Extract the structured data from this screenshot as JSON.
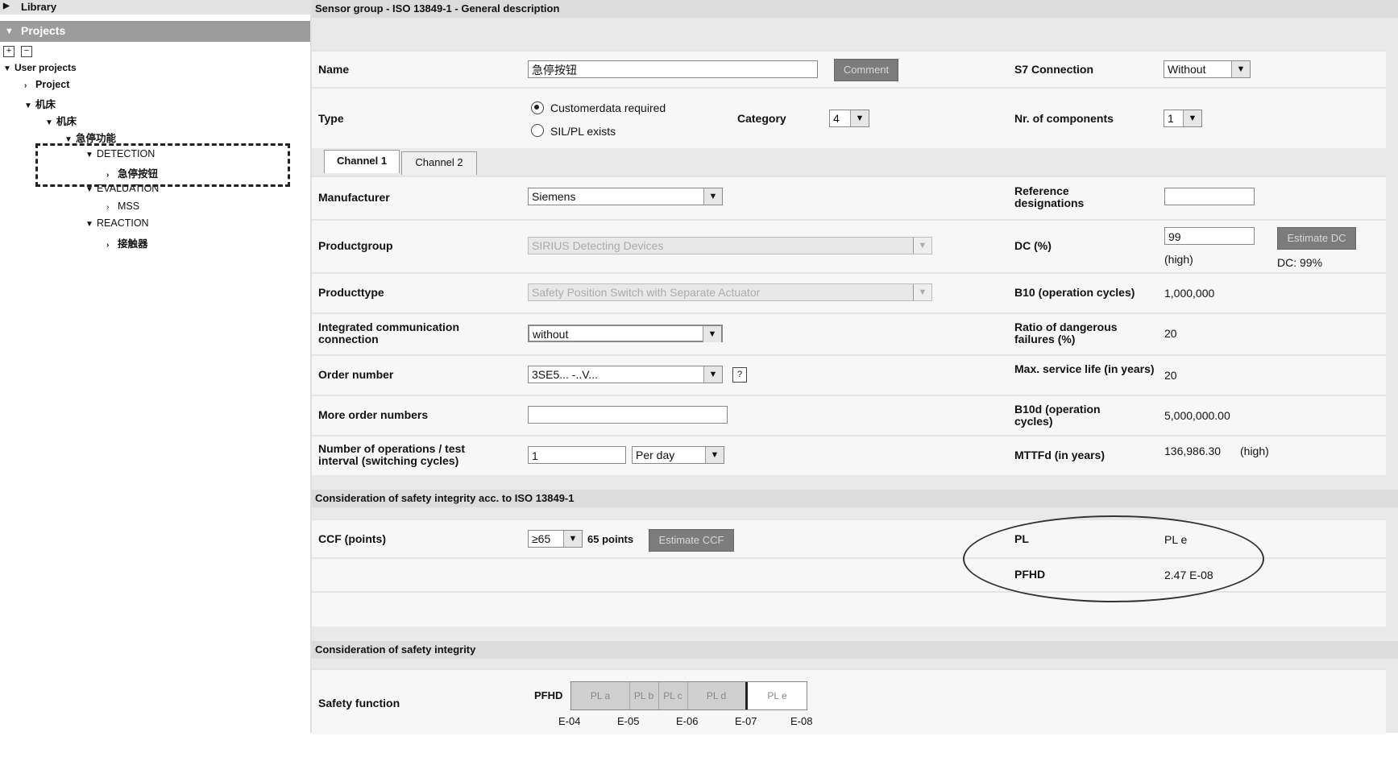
{
  "tree": {
    "library": "Library",
    "projects": "Projects",
    "expand_btn": "+",
    "collapse_btn": "−",
    "nodes": [
      {
        "label": "User projects",
        "tri": "▼"
      },
      {
        "label": "Project",
        "tri": "›"
      },
      {
        "label": "机床",
        "tri": "▼"
      },
      {
        "label": "机床",
        "tri": "▼"
      },
      {
        "label": "急停功能",
        "tri": "▼"
      },
      {
        "label": "DETECTION",
        "tri": "▼"
      },
      {
        "label": "急停按钮",
        "tri": "›"
      },
      {
        "label": "EVALUATION",
        "tri": "▼"
      },
      {
        "label": "MSS",
        "tri": "›"
      },
      {
        "label": "REACTION",
        "tri": "▼"
      },
      {
        "label": "接触器",
        "tri": "›"
      }
    ]
  },
  "header": {
    "title": "Sensor group - ISO 13849-1 - General description"
  },
  "general": {
    "name_label": "Name",
    "name_value": "急停按钮",
    "comment_btn": "Comment",
    "s7_label": "S7 Connection",
    "s7_value": "Without",
    "type_label": "Type",
    "type_opt1": "Customerdata required",
    "type_opt2": "SIL/PL exists",
    "category_label": "Category",
    "category_value": "4",
    "components_label": "Nr. of components",
    "components_value": "1"
  },
  "tabs": [
    "Channel 1",
    "Channel 2"
  ],
  "channel": {
    "manufacturer_label": "Manufacturer",
    "manufacturer_value": "Siemens",
    "refdes_label": "Reference designations",
    "productgroup_label": "Productgroup",
    "productgroup_value": "SIRIUS Detecting Devices",
    "dc_label": "DC (%)",
    "dc_value": "99",
    "dc_high": "(high)",
    "estimate_dc_btn": "Estimate DC",
    "dc_result": "DC: 99%",
    "producttype_label": "Producttype",
    "producttype_value": "Safety Position Switch with Separate Actuator",
    "b10_label": "B10 (operation cycles)",
    "b10_value": "1,000,000",
    "comm_label": "Integrated communication connection",
    "comm_value": "without",
    "ratio_label": "Ratio of dangerous failures (%)",
    "ratio_value": "20",
    "order_label": "Order number",
    "order_value": "3SE5... -..V...",
    "order_help": "?",
    "service_label": "Max. service life (in years)",
    "service_value": "20",
    "more_order_label": "More order numbers",
    "b10d_label": "B10d (operation cycles)",
    "b10d_value": "5,000,000.00",
    "ops_label": "Number of operations / test interval (switching cycles)",
    "ops_value": "1",
    "ops_unit": "Per day",
    "mttfd_label": "MTTFd (in years)",
    "mttfd_value": "136,986.30",
    "mttfd_high": "(high)"
  },
  "safety": {
    "header": "Consideration of safety integrity acc. to ISO 13849-1",
    "ccf_label": "CCF (points)",
    "ccf_value": "≥65",
    "ccf_points": "65 points",
    "estimate_ccf_btn": "Estimate CCF",
    "pl_label": "PL",
    "pl_value": "PL e",
    "pfhd_label": "PFHD",
    "pfhd_value": "2.47 E-08"
  },
  "integrity": {
    "header": "Consideration of safety integrity",
    "function_label": "Safety function",
    "pfhd_label": "PFHD",
    "segments": [
      "PL a",
      "PL b",
      "PL c",
      "PL d",
      "PL e"
    ],
    "ticks": [
      "E-04",
      "E-05",
      "E-06",
      "E-07",
      "E-08"
    ]
  }
}
